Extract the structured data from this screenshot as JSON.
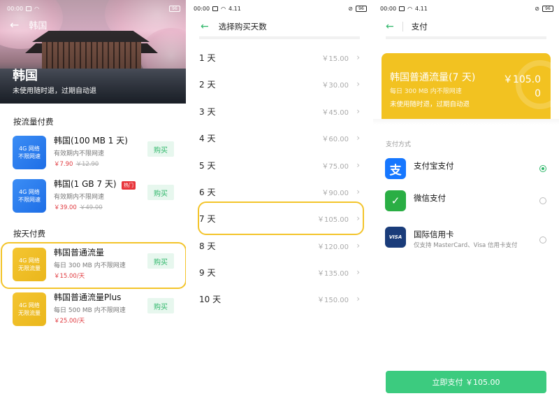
{
  "status_time": "00:00",
  "status_net": "4.11",
  "battery": "96",
  "screen1": {
    "nav_title": "韩国",
    "hero_title": "韩国",
    "hero_subtitle": "未使用随时退，过期自动退",
    "section_flow": "按流量付费",
    "section_day": "按天付费",
    "buy_label": "购买",
    "hot_label": "热门",
    "tile_top": "4G 网络",
    "tile_bottom": "不限网速",
    "tile_bottom_yellow": "无限流量",
    "products": [
      {
        "name": "韩国(100 MB 1 天)",
        "desc": "有效期内不限网速",
        "price": "￥7.90",
        "old": "￥12.90"
      },
      {
        "name": "韩国(1 GB 7 天)",
        "desc": "有效期内不限网速",
        "price": "￥39.00",
        "old": "￥49.00"
      },
      {
        "name": "韩国普通流量",
        "desc": "每日 300 MB 内不限网速",
        "price": "￥15.00/天",
        "old": ""
      },
      {
        "name": "韩国普通流量Plus",
        "desc": "每日 500 MB 内不限网速",
        "price": "￥25.00/天",
        "old": ""
      }
    ]
  },
  "screen2": {
    "title": "选择购买天数",
    "days": [
      {
        "day": "1 天",
        "price": "￥15.00"
      },
      {
        "day": "2 天",
        "price": "￥30.00"
      },
      {
        "day": "3 天",
        "price": "￥45.00"
      },
      {
        "day": "4 天",
        "price": "￥60.00"
      },
      {
        "day": "5 天",
        "price": "￥75.00"
      },
      {
        "day": "6 天",
        "price": "￥90.00"
      },
      {
        "day": "7 天",
        "price": "￥105.00"
      },
      {
        "day": "8 天",
        "price": "￥120.00"
      },
      {
        "day": "9 天",
        "price": "￥135.00"
      },
      {
        "day": "10 天",
        "price": "￥150.00"
      }
    ]
  },
  "screen3": {
    "title": "支付",
    "summary_title": "韩国普通流量(7 天)",
    "summary_desc": "每日 300 MB 内不限网速",
    "summary_note": "未使用随时退，过期自动退",
    "summary_amount": "￥105.00",
    "method_label": "支付方式",
    "methods": [
      {
        "label": "支付宝支付",
        "sub": "",
        "icon_text": "支",
        "color": "#1677ff"
      },
      {
        "label": "微信支付",
        "sub": "",
        "icon_text": "✓",
        "color": "#2aae44"
      },
      {
        "label": "国际信用卡",
        "sub": "仅支持 MasterCard、Visa 信用卡支付",
        "icon_text": "VISA",
        "color": "#1a3c7a"
      }
    ],
    "pay_button": "立即支付 ￥105.00"
  },
  "colors": {
    "green": "#3ccb7f",
    "yellow": "#f2c221",
    "blue_tile": "#2a7ef0",
    "red": "#e0393e"
  }
}
